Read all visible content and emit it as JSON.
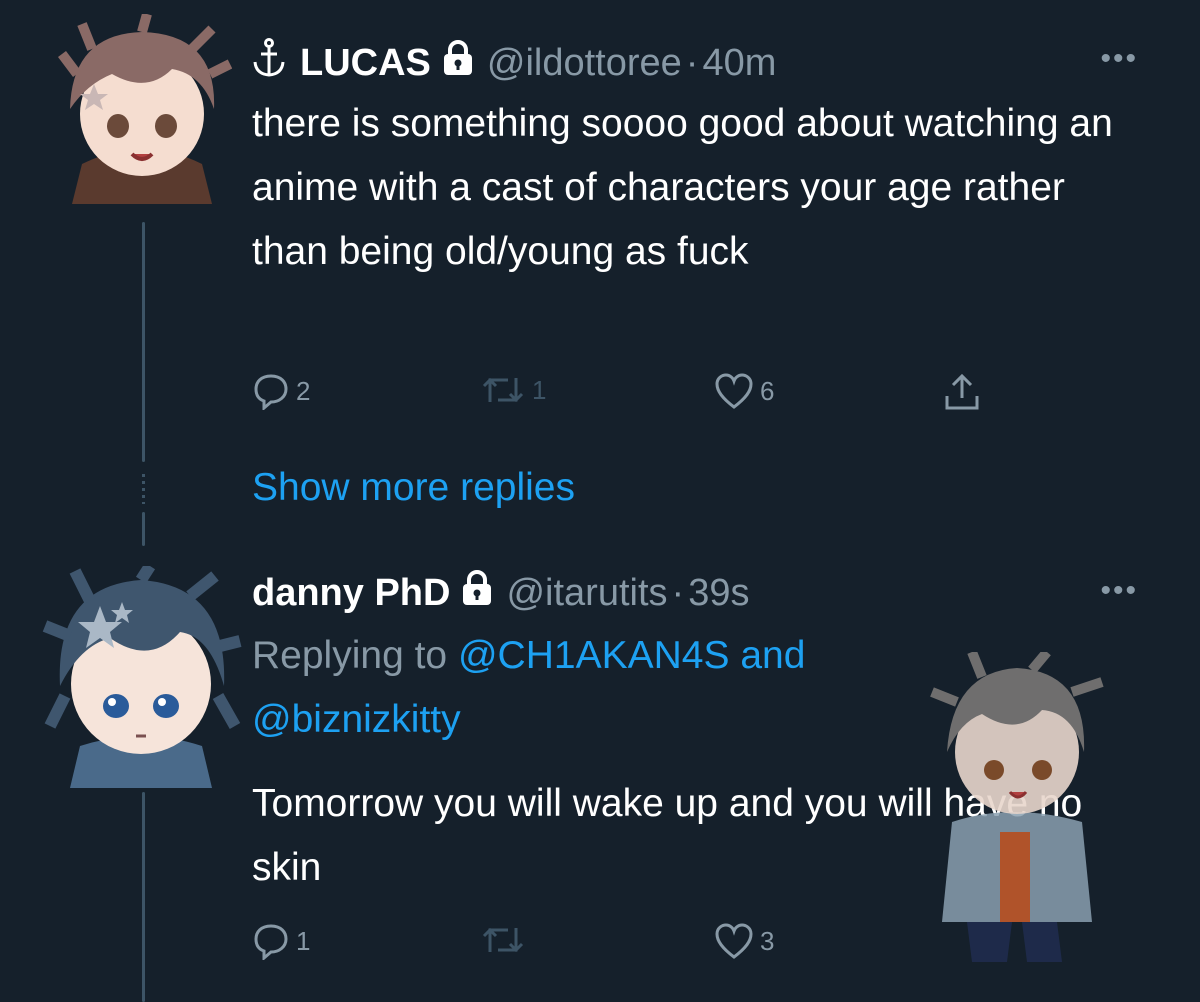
{
  "tweets": [
    {
      "name": "LUCAS",
      "handle": "@ildottoree",
      "separator": "·",
      "time": "40m",
      "more": "•••",
      "text": "there is something soooo good about watching an anime with a cast of characters your age rather than being old/young as fuck",
      "replies": "2",
      "retweets": "1",
      "likes": "6"
    },
    {
      "name": "danny PhD",
      "handle": "@itarutits",
      "separator": "·",
      "time": "39s",
      "more": "•••",
      "replying_prefix": "Replying to",
      "replying_user1": "@CH1AKAN4S",
      "replying_and": "and",
      "replying_user2": "@biznizkitty",
      "text": "Tomorrow you will wake up and you will have no skin",
      "replies": "1",
      "likes": "3"
    }
  ],
  "show_more_replies": "Show more replies",
  "colors": {
    "background": "#15202b",
    "accent": "#1da1f2",
    "muted": "#8899a6"
  },
  "icons": [
    "anchor-icon",
    "lock-icon",
    "reply-icon",
    "retweet-icon",
    "like-icon",
    "share-icon",
    "more-icon"
  ]
}
